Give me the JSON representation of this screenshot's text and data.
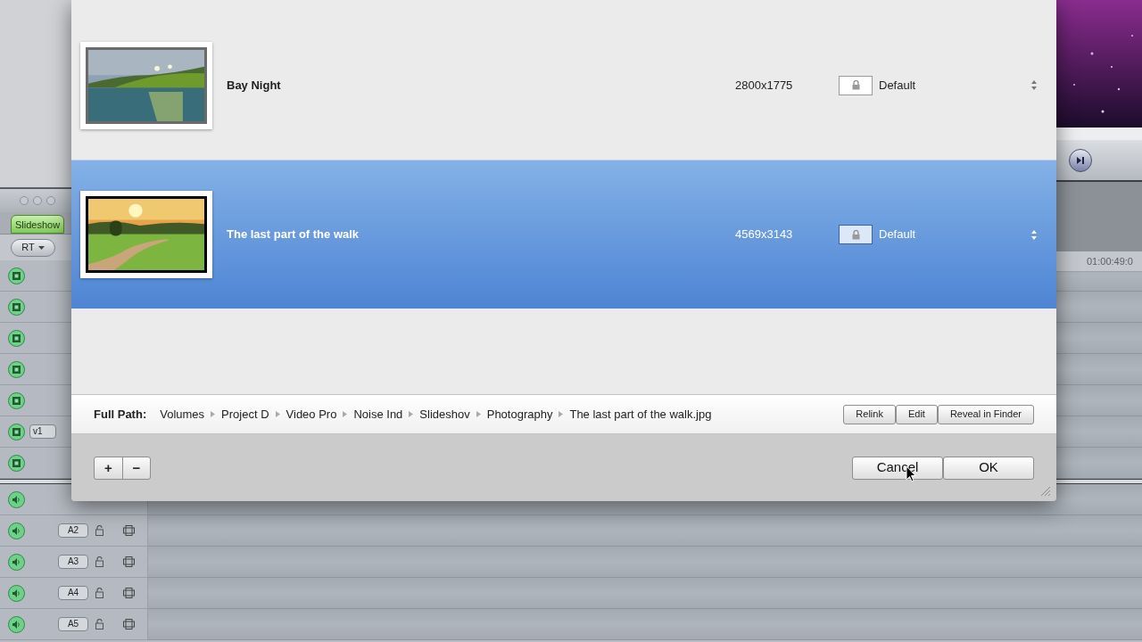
{
  "timeline": {
    "tab": {
      "label": "Slideshow",
      "selected": true
    },
    "rt_menu": "RT",
    "video_tracks": [
      {
        "enabled": true
      },
      {
        "enabled": true
      },
      {
        "enabled": true
      },
      {
        "enabled": true
      },
      {
        "enabled": true
      },
      {
        "enabled": true,
        "source": "v1"
      },
      {
        "enabled": true
      }
    ],
    "audio_tracks": [
      {
        "enabled": true
      },
      {
        "enabled": true,
        "label": "A2"
      },
      {
        "enabled": true,
        "label": "A3"
      },
      {
        "enabled": true,
        "label": "A4"
      },
      {
        "enabled": true,
        "label": "A5"
      }
    ]
  },
  "viewer": {
    "timecode": "01:00:49:0"
  },
  "dialog": {
    "media": [
      {
        "name": "Bay Night",
        "dimensions": "2800x1775",
        "setting": "Default",
        "selected": false
      },
      {
        "name": "The last part of the walk",
        "dimensions": "4569x3143",
        "setting": "Default",
        "selected": true
      }
    ],
    "path": {
      "label": "Full Path:",
      "segments": [
        "Volumes",
        "Project D",
        "Video Pro",
        "Noise Ind",
        "Slideshov",
        "Photography",
        "The last part of the walk.jpg"
      ]
    },
    "path_buttons": [
      "Relink",
      "Edit",
      "Reveal in Finder"
    ],
    "list_buttons": [
      "+",
      "−"
    ],
    "buttons": [
      "Cancel",
      "OK"
    ]
  }
}
